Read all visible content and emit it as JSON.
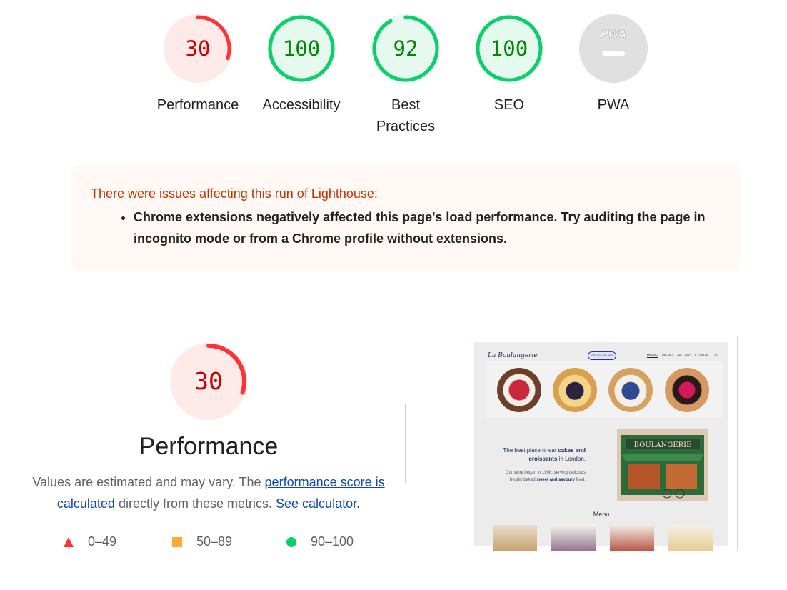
{
  "categories": [
    {
      "label": "Performance",
      "score": "30",
      "fraction": 0.3,
      "status": "fail"
    },
    {
      "label": "Accessibility",
      "score": "100",
      "fraction": 1.0,
      "status": "pass"
    },
    {
      "label": "Best Practices",
      "label_line1": "Best",
      "label_line2": "Practices",
      "score": "92",
      "fraction": 0.92,
      "status": "pass"
    },
    {
      "label": "SEO",
      "score": "100",
      "fraction": 1.0,
      "status": "pass"
    },
    {
      "label": "PWA",
      "score": "",
      "status": "na",
      "badge_text": "PWA"
    }
  ],
  "colors": {
    "fail": "#ff3333",
    "fail_bg": "#ffeaea",
    "fail_text": "#cc0000",
    "average": "#ffaa33",
    "pass": "#0cce6b",
    "pass_bg": "#e5f9ee",
    "pass_text": "#008800",
    "na_bg": "#e0e0e0"
  },
  "warning": {
    "title": "There were issues affecting this run of Lighthouse:",
    "items": [
      "Chrome extensions negatively affected this page's load performance. Try auditing the page in incognito mode or from a Chrome profile without extensions."
    ]
  },
  "performance": {
    "score": "30",
    "fraction": 0.3,
    "title": "Performance",
    "desc_before": "Values are estimated and may vary. The ",
    "desc_link1": "performance score is calculated",
    "desc_middle": " directly from these metrics. ",
    "desc_link2": "See calculator."
  },
  "legend": [
    {
      "icon": "triangle-icon",
      "range": "0–49"
    },
    {
      "icon": "square-icon",
      "range": "50–89"
    },
    {
      "icon": "circle-icon",
      "range": "90–100"
    }
  ],
  "screenshot": {
    "brand": "La Boulangerie",
    "order_button": "ORDER ONLINE",
    "nav": [
      "HOME",
      "MENU",
      "GALLERY",
      "CONTACT US"
    ],
    "tagline_prefix": "The best place to eat ",
    "tagline_b1": "cakes",
    "tagline_mid": " and croissants",
    "tagline_suffix": " in London.",
    "story_prefix": "Our story began in 1998, serving delicious freshly baked ",
    "story_b": "sweet and savoury",
    "story_suffix": " food.",
    "store_sign": "BOULANGERIE",
    "menu_title": "Menu"
  }
}
